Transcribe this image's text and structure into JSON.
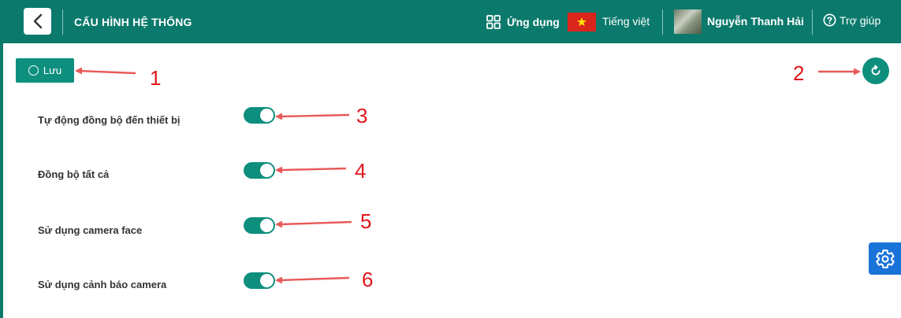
{
  "header": {
    "title": "CẤU HÌNH HỆ THỐNG",
    "apps_label": "Ứng dụng",
    "language": "Tiếng việt",
    "user_name": "Nguyễn Thanh Hải",
    "help_label": "Trợ giúp"
  },
  "toolbar": {
    "save_label": "Lưu"
  },
  "settings": [
    {
      "label": "Tự động đồng bộ đến thiết bị",
      "enabled": true
    },
    {
      "label": "Đồng bộ tất cả",
      "enabled": true
    },
    {
      "label": "Sử dụng camera face",
      "enabled": true
    },
    {
      "label": "Sử dụng cảnh báo camera",
      "enabled": true
    }
  ],
  "annotations": [
    "1",
    "2",
    "3",
    "4",
    "5",
    "6"
  ],
  "colors": {
    "header_bg": "#0b7a6c",
    "accent": "#0e8f7e",
    "annotation": "#e0161c",
    "gear_fab": "#1a73d9"
  },
  "icons": [
    "back-icon",
    "apps-grid-icon",
    "vietnam-flag-icon",
    "help-icon",
    "save-circle-icon",
    "refresh-icon",
    "gear-icon"
  ]
}
